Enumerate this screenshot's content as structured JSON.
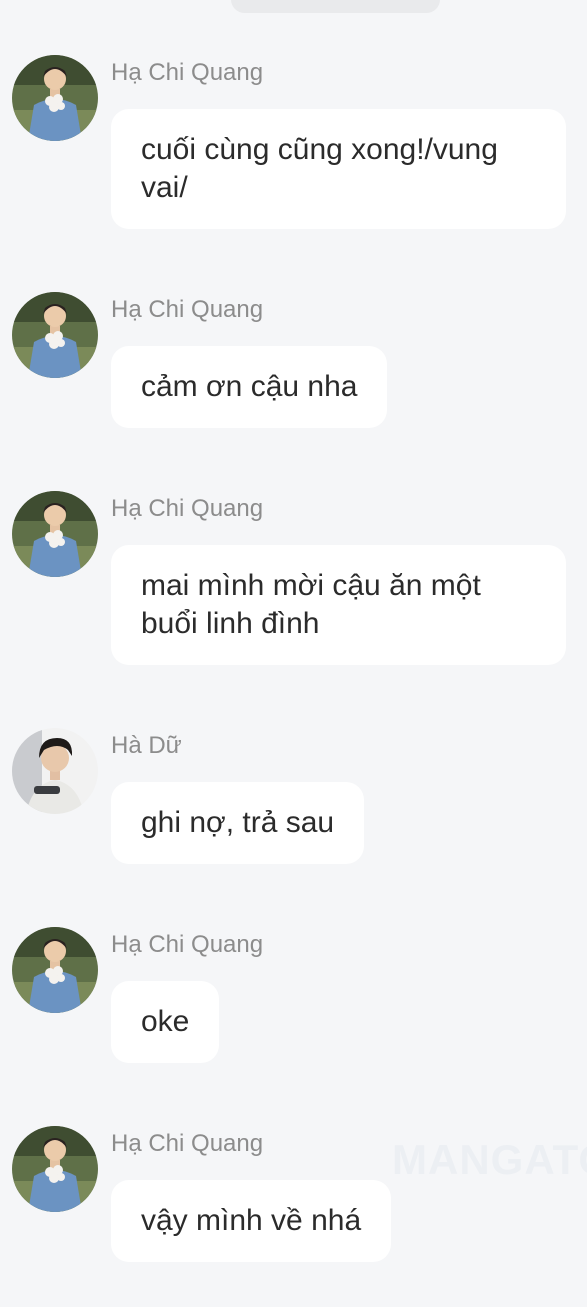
{
  "messages": [
    {
      "sender": "Hạ Chi Quang",
      "avatar": "avatar-man-flowers",
      "text": "cuối cùng cũng xong!/vung vai/"
    },
    {
      "sender": "Hạ Chi Quang",
      "avatar": "avatar-man-flowers",
      "text": "cảm ơn cậu nha"
    },
    {
      "sender": "Hạ Chi Quang",
      "avatar": "avatar-man-flowers",
      "text": "mai mình mời cậu ăn một buổi linh đình"
    },
    {
      "sender": "Hà Dữ",
      "avatar": "avatar-man-dark-hair",
      "text": "ghi nợ, trả sau"
    },
    {
      "sender": "Hạ Chi Quang",
      "avatar": "avatar-man-flowers",
      "text": "oke"
    },
    {
      "sender": "Hạ Chi Quang",
      "avatar": "avatar-man-flowers",
      "text": "vậy mình về nhá"
    }
  ],
  "watermark": "MANGATO"
}
